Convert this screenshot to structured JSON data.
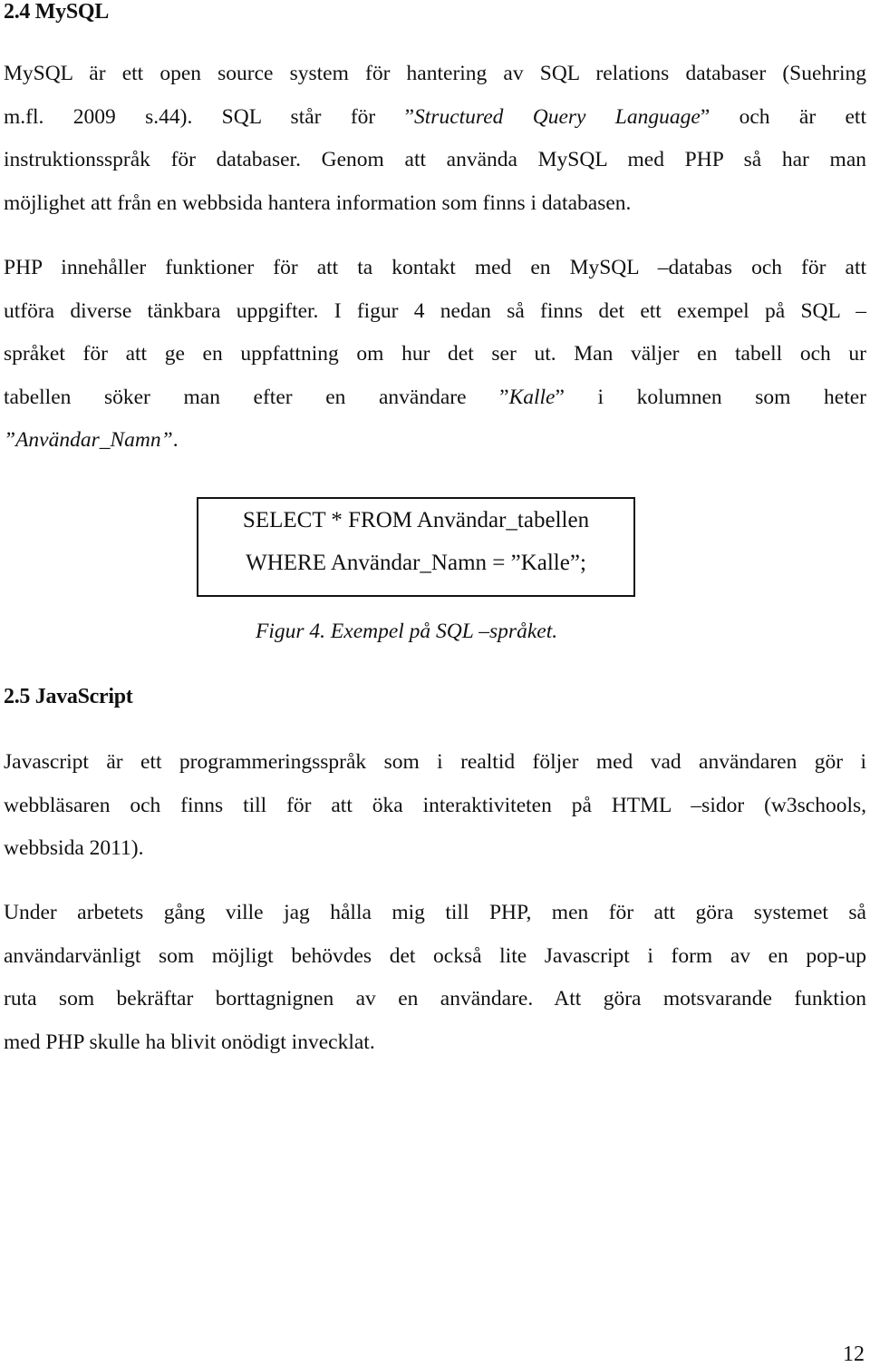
{
  "sections": [
    {
      "heading": "2.4 MySQL",
      "paragraphs": [
        {
          "lines": [
            "MySQL är ett open source system för hantering av SQL relations databaser (Suehring",
            "m.fl. 2009 s.44). SQL står för ”Structured Query Language” och är ett",
            "instruktionsspråk för databaser. Genom att använda MySQL med PHP så har man",
            "möjlighet att från en webbsida hantera information som finns i databasen."
          ],
          "line2_parts": {
            "before": "m.fl. 2009 s.44). SQL står för ”",
            "italic": "Structured Query Language",
            "after": "” och är ett"
          }
        },
        {
          "lines": [
            "PHP innehåller funktioner för att ta kontakt med en MySQL –databas och för att",
            "utföra diverse tänkbara uppgifter. I figur 4 nedan så finns det ett exempel på SQL –",
            "språket för att ge en uppfattning om hur det ser ut. Man väljer en tabell och ur",
            "tabellen söker man efter en användare ”Kalle” i kolumnen som heter",
            "”Användar_Namn”."
          ],
          "line4_parts": {
            "before": "tabellen söker man efter en användare ”",
            "italic": "Kalle",
            "after": "” i kolumnen som heter"
          },
          "line5_parts": {
            "italic": "”Användar_Namn”",
            "after": "."
          }
        }
      ],
      "figure": {
        "code_lines": [
          "SELECT * FROM Användar_tabellen",
          "WHERE Användar_Namn = ”Kalle”;"
        ],
        "caption": "Figur 4. Exempel på SQL –språket."
      }
    },
    {
      "heading": "2.5 JavaScript",
      "paragraphs": [
        {
          "lines": [
            "Javascript är ett programmeringsspråk som i realtid följer med vad användaren gör i",
            "webbläsaren och finns till för att öka interaktiviteten på HTML –sidor (w3schools,",
            "webbsida 2011)."
          ]
        },
        {
          "lines": [
            "Under arbetets gång ville jag hålla mig till PHP, men för att göra systemet så",
            "användarvänligt som möjligt behövdes det också lite Javascript i form av en pop-up",
            "ruta som bekräftar borttagnignen av en användare. Att göra motsvarande funktion",
            "med PHP skulle ha blivit onödigt invecklat."
          ]
        }
      ]
    }
  ],
  "page_number": "12"
}
